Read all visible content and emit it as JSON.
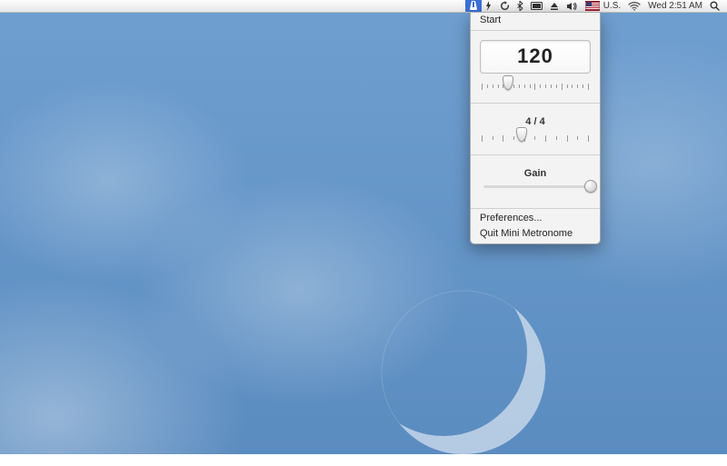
{
  "menubar": {
    "flag_code": "U.S.",
    "clock": "Wed 2:51 AM"
  },
  "panel": {
    "start_label": "Start",
    "bpm_value": "120",
    "bpm_slider_percent": 25,
    "timesig_label": "4 / 4",
    "timesig_slider_percent": 38,
    "gain_label": "Gain",
    "gain_slider_percent": 100,
    "prefs_label": "Preferences...",
    "quit_label": "Quit Mini Metronome"
  }
}
